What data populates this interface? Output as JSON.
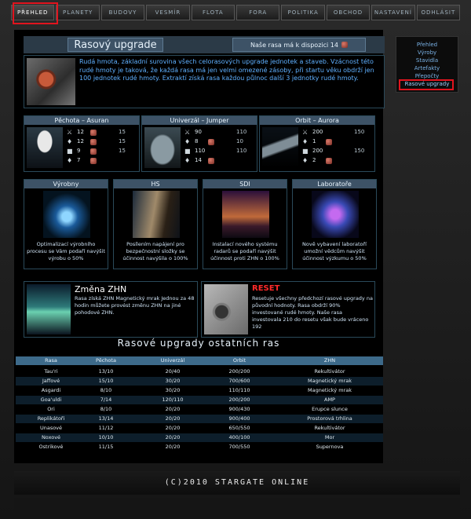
{
  "nav": {
    "items": [
      "PŘEHLED",
      "PLANETY",
      "BUDOVY",
      "VESMÍR",
      "FLOTA",
      "FORA",
      "POLITIKA",
      "OBCHOD",
      "NASTAVENÍ",
      "ODHLÁSIT"
    ],
    "active_index": 0
  },
  "side_menu": {
    "items": [
      "Přehled",
      "Výroby",
      "Stavidla",
      "Artefakty",
      "Přepočty",
      "Rasové upgrady"
    ],
    "active_index": 5
  },
  "upgrade": {
    "title": "Rasový upgrade",
    "points_label": "Naše rasa má k dispozici 14",
    "intro": "Rudá hmota, základní surovina všech celorasových upgrade jednotek a staveb. Vzácnost této rudé hmoty je taková, že každá rasa má jen velmi omezené zásoby, při startu věku obdrží jen 100 jednotek rudé hmoty. Extraktí získá rasa každou půlnoc další 3 jednotky rudé hmoty."
  },
  "units": [
    {
      "name": "Pěchota – Asuran",
      "stats": [
        {
          "icon": "sword",
          "value": "12",
          "ore": true,
          "max": "15"
        },
        {
          "icon": "shield",
          "value": "12",
          "ore": true,
          "max": "15"
        },
        {
          "icon": "armor",
          "value": "9",
          "ore": true,
          "max": "15"
        },
        {
          "icon": "shield2",
          "value": "7",
          "ore": true,
          "max": ""
        }
      ]
    },
    {
      "name": "Univerzál – Jumper",
      "stats": [
        {
          "icon": "sword",
          "value": "90",
          "ore": false,
          "max": "110"
        },
        {
          "icon": "shield",
          "value": "8",
          "ore": true,
          "max": "10"
        },
        {
          "icon": "armor",
          "value": "110",
          "ore": false,
          "max": "110"
        },
        {
          "icon": "shield2",
          "value": "14",
          "ore": true,
          "max": ""
        }
      ]
    },
    {
      "name": "Orbit – Aurora",
      "stats": [
        {
          "icon": "sword",
          "value": "200",
          "ore": false,
          "max": "150"
        },
        {
          "icon": "shield",
          "value": "1",
          "ore": true,
          "max": ""
        },
        {
          "icon": "armor",
          "value": "200",
          "ore": false,
          "max": "150"
        },
        {
          "icon": "shield2",
          "value": "2",
          "ore": true,
          "max": ""
        }
      ]
    }
  ],
  "buildings": [
    {
      "name": "Výrobny",
      "text": "Optimalizací výrobního procesu se Vám podaří navýšit výrobu o 50%"
    },
    {
      "name": "HS",
      "text": "Posílením napájení pro bezpečnostní složky se účinnost navýšila o 100%"
    },
    {
      "name": "SDI",
      "text": "Instalací nového systému radarů se podaří navýšit účinnost proti ZHN o 100%"
    },
    {
      "name": "Laboratoře",
      "text": "Nově vybavení laboratoří umožní vědcům navýšit účinnost výzkumu o 50%"
    }
  ],
  "specials": [
    {
      "title": "Změna ZHN",
      "text": "Rasa získá ZHN Magnetický mrak Jednou za 48 hodin můžete provést změnu ZHN na jiné pohodové ZHN."
    },
    {
      "title": "RESET",
      "text": "Resetuje všechny předchozí rasové upgrady na původní hodnoty. Rasa obdrží 90% investované rudé hmoty. Naše rasa investovala 210 do resetu však bude vráceno 192"
    }
  ],
  "others_title": "Rasové upgrady ostatních ras",
  "others_table": {
    "headers": [
      "Rasa",
      "Pěchota",
      "Univerzál",
      "Orbit",
      "ZHN"
    ],
    "rows": [
      [
        "Tau'ri",
        "13/10",
        "20/40",
        "200/200",
        "Rekultivátor"
      ],
      [
        "Jaffové",
        "15/10",
        "30/20",
        "700/600",
        "Magnetický mrak"
      ],
      [
        "Asgardi",
        "8/10",
        "30/20",
        "110/110",
        "Magnetický mrak"
      ],
      [
        "Goa'uldi",
        "7/14",
        "120/110",
        "200/200",
        "AMP"
      ],
      [
        "Ori",
        "8/10",
        "20/20",
        "900/430",
        "Erupce slunce"
      ],
      [
        "Replikátoři",
        "13/14",
        "20/20",
        "900/400",
        "Prostorová trhlina"
      ],
      [
        "Unasové",
        "11/12",
        "20/20",
        "650/550",
        "Rekultivátor"
      ],
      [
        "Noxové",
        "10/10",
        "20/20",
        "400/100",
        "Mor"
      ],
      [
        "Ostrikové",
        "11/15",
        "20/20",
        "700/550",
        "Supernova"
      ]
    ]
  },
  "footer": {
    "title": "(C)2010 STARGATE ONLINE"
  },
  "colors": {
    "accent": "#5fb0ff",
    "header_bar": "#3d5266",
    "highlight_red": "#e0141e"
  }
}
